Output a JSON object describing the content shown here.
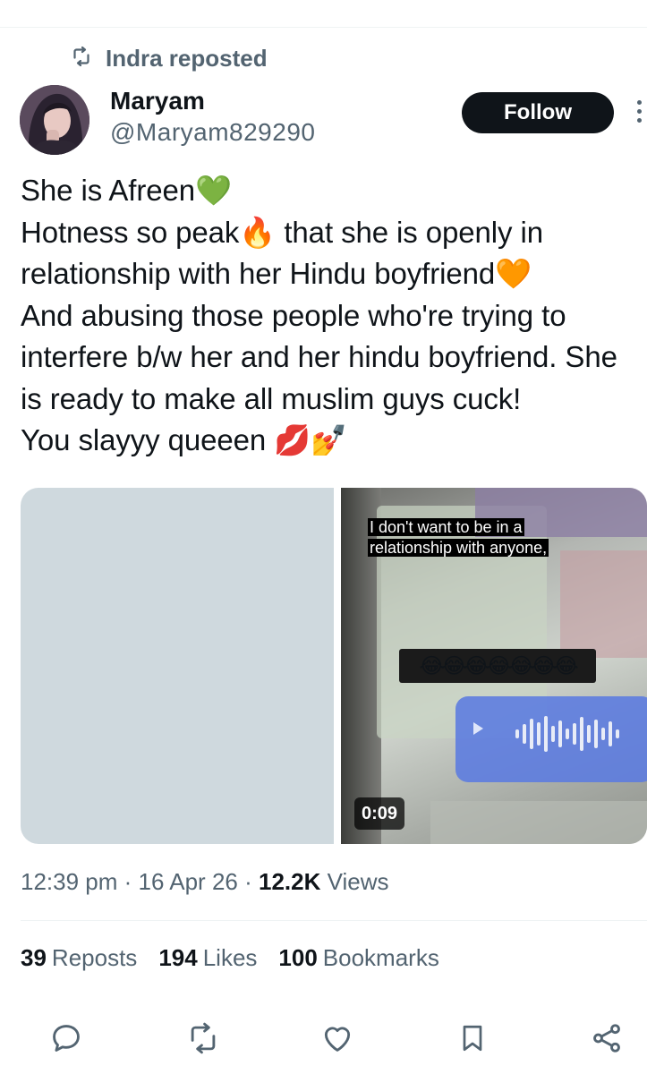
{
  "repost": {
    "icon": "repost-icon",
    "text": "Indra reposted"
  },
  "author": {
    "name": "Maryam",
    "handle": "@Maryam829290",
    "avatar_icon": "avatar-image"
  },
  "follow_label": "Follow",
  "tweet_text": "She is Afreen💚\nHotness so peak🔥 that she is openly in relationship with her Hindu boyfriend🧡\nAnd abusing those people who're trying to interfere b/w her and her hindu boyfriend. She is ready to make all muslim guys cuck!\nYou slayyy queeen 💋💅",
  "media": {
    "caption_line1": "I don't want to be in a",
    "caption_line2": "relationship with anyone,",
    "emoji_band": "😂😂😂😂😂😂😂",
    "duration": "0:09"
  },
  "meta": {
    "time": "12:39 pm",
    "sep1": "·",
    "date": "16 Apr 26",
    "sep2": "·",
    "views_count": "12.2K",
    "views_label": "Views"
  },
  "stats": {
    "reposts_count": "39",
    "reposts_label": "Reposts",
    "likes_count": "194",
    "likes_label": "Likes",
    "bookmarks_count": "100",
    "bookmarks_label": "Bookmarks"
  },
  "actions": [
    "reply-icon",
    "repost-icon",
    "like-icon",
    "bookmark-icon",
    "share-icon"
  ],
  "colors": {
    "text_primary": "#0f1419",
    "text_secondary": "#536471",
    "divider": "#eff3f4",
    "media_placeholder": "#cfd9de"
  }
}
